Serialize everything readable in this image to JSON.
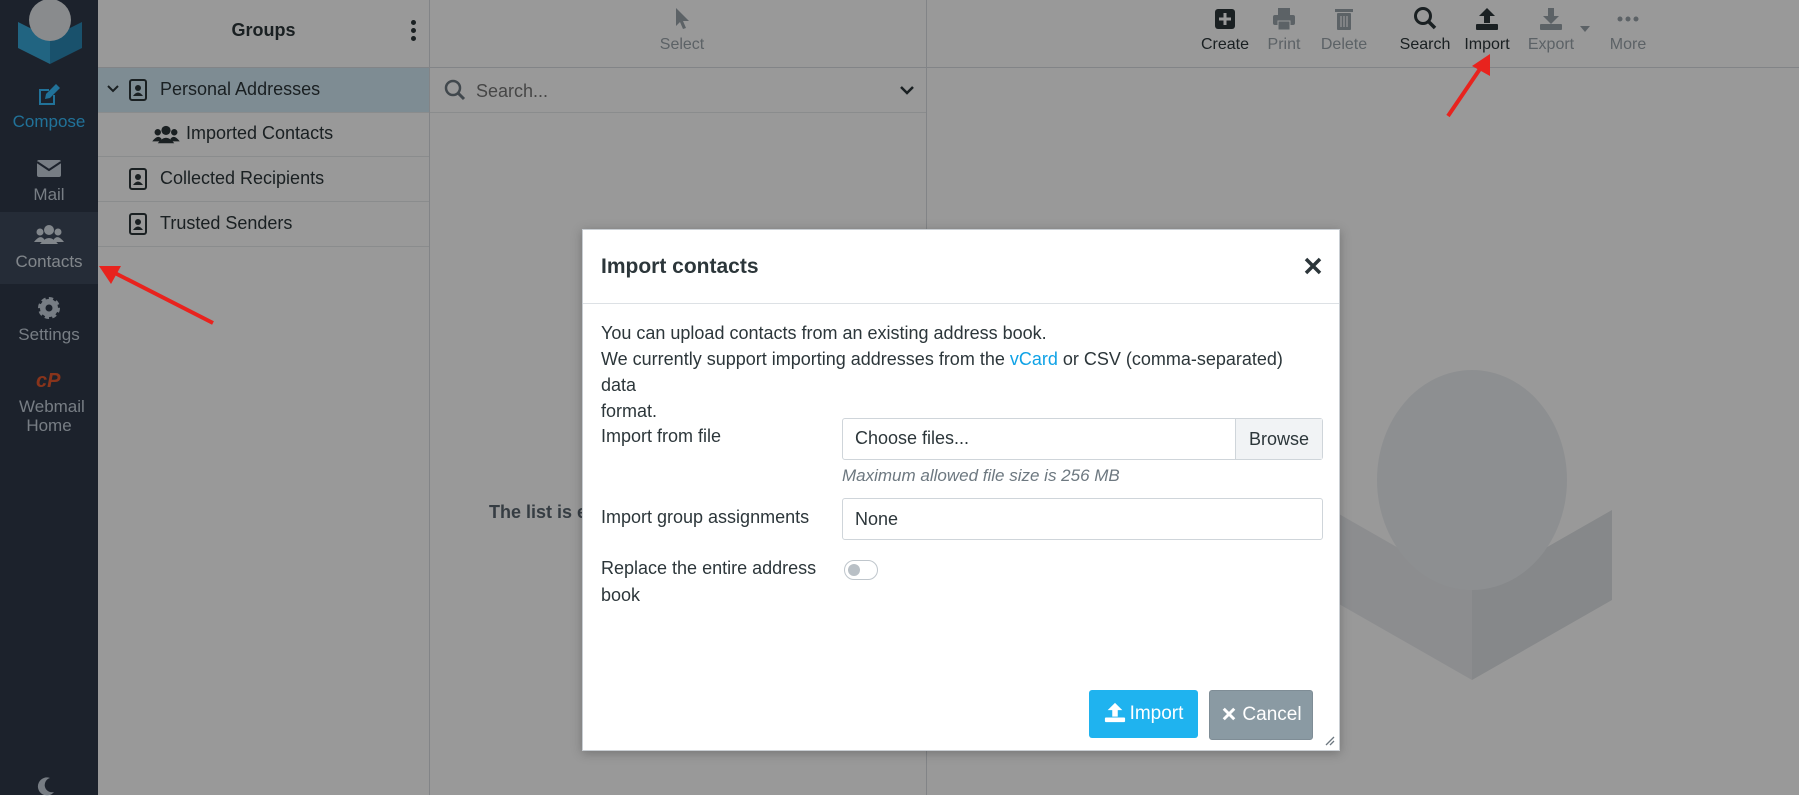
{
  "sidebar": {
    "items": [
      {
        "label": "Compose",
        "icon": "compose-icon"
      },
      {
        "label": "Mail",
        "icon": "mail-icon"
      },
      {
        "label": "Contacts",
        "icon": "contacts-icon"
      },
      {
        "label": "Settings",
        "icon": "gear-icon"
      },
      {
        "label": "Webmail Home",
        "icon": "cpanel-icon"
      }
    ]
  },
  "groups": {
    "title": "Groups",
    "rows": [
      {
        "label": "Personal Addresses"
      },
      {
        "label": "Imported Contacts"
      },
      {
        "label": "Collected Recipients"
      },
      {
        "label": "Trusted Senders"
      }
    ]
  },
  "list": {
    "select_label": "Select",
    "search_placeholder": "Search...",
    "empty_text": "The list is er"
  },
  "toolbar": {
    "create": "Create",
    "print": "Print",
    "delete": "Delete",
    "search": "Search",
    "import": "Import",
    "export": "Export",
    "more": "More"
  },
  "dialog": {
    "title": "Import contacts",
    "line1": "You can upload contacts from an existing address book.",
    "line2_pre": "We currently support importing addresses from the ",
    "line2_link": "vCard",
    "line2_post": " or CSV (comma-separated) data",
    "line3": "format.",
    "file_label": "Import from file",
    "file_value": "Choose files...",
    "browse_label": "Browse",
    "file_hint": "Maximum allowed file size is 256 MB",
    "group_label": "Import group assignments",
    "group_value": "None",
    "replace_label_1": "Replace the entire address",
    "replace_label_2": "book",
    "replace_enabled": false,
    "import_button": "Import",
    "cancel_button": "Cancel"
  },
  "colors": {
    "sidebar_bg": "#2f3a4a",
    "accent": "#37beff",
    "import_button": "#1fb3ef",
    "cancel_button": "#8a9aa3",
    "annotation_arrow": "#e8231e"
  }
}
